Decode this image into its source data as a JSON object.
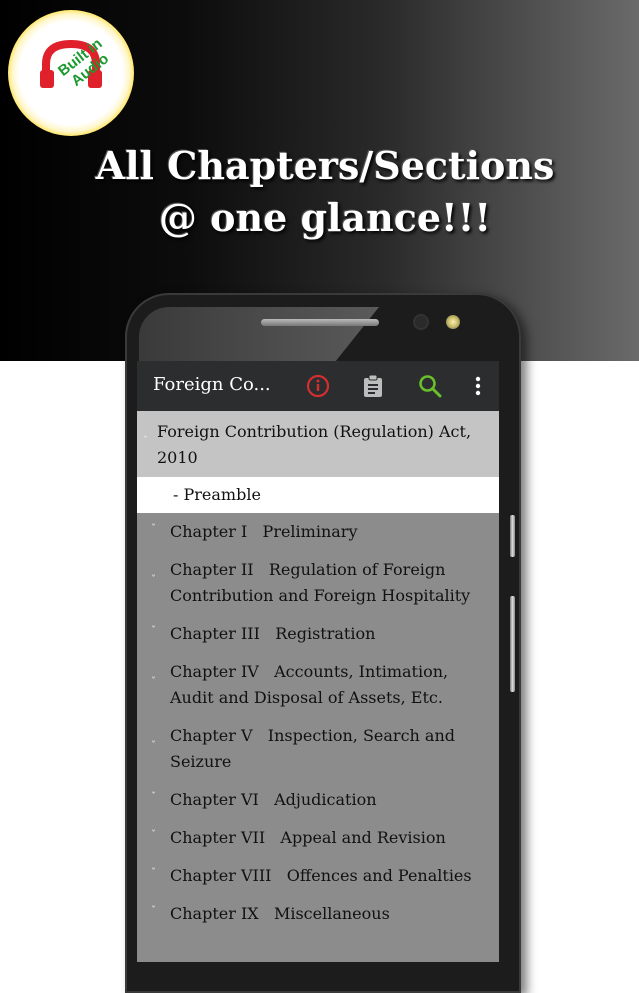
{
  "promo": {
    "badge_line1": "Built in",
    "badge_line2": "Audio",
    "badge_icon": "headphones-icon",
    "headline_line1": "All Chapters/Sections",
    "headline_line2": "@ one glance!!!"
  },
  "colors": {
    "appbar": "#2b2d2f",
    "info_icon": "#d32f2f",
    "search_icon": "#6abf2a",
    "root_bg": "#c4c4c4",
    "selected_bg": "#ffffff",
    "list_bg": "#8c8c8c",
    "badge_text": "#1a9a2e",
    "badge_icon": "#e0202a"
  },
  "appbar": {
    "title": "Foreign Co...",
    "icons": [
      "info-icon",
      "clipboard-icon",
      "search-icon",
      "more-vert-icon"
    ]
  },
  "tree": {
    "root": "Foreign Contribution (Regulation) Act, 2010",
    "selected": "- Preamble",
    "chapters": [
      {
        "number": "Chapter I",
        "title": "Preliminary"
      },
      {
        "number": "Chapter II",
        "title": "Regulation of Foreign Contribution and Foreign Hospitality"
      },
      {
        "number": "Chapter III",
        "title": "Registration"
      },
      {
        "number": "Chapter IV",
        "title": "Accounts, Intimation, Audit and Disposal of Assets, Etc."
      },
      {
        "number": "Chapter V",
        "title": "Inspection, Search and Seizure"
      },
      {
        "number": "Chapter VI",
        "title": "Adjudication"
      },
      {
        "number": "Chapter VII",
        "title": "Appeal and Revision"
      },
      {
        "number": "Chapter VIII",
        "title": "Offences and Penalties"
      },
      {
        "number": "Chapter IX",
        "title": "Miscellaneous"
      }
    ]
  }
}
